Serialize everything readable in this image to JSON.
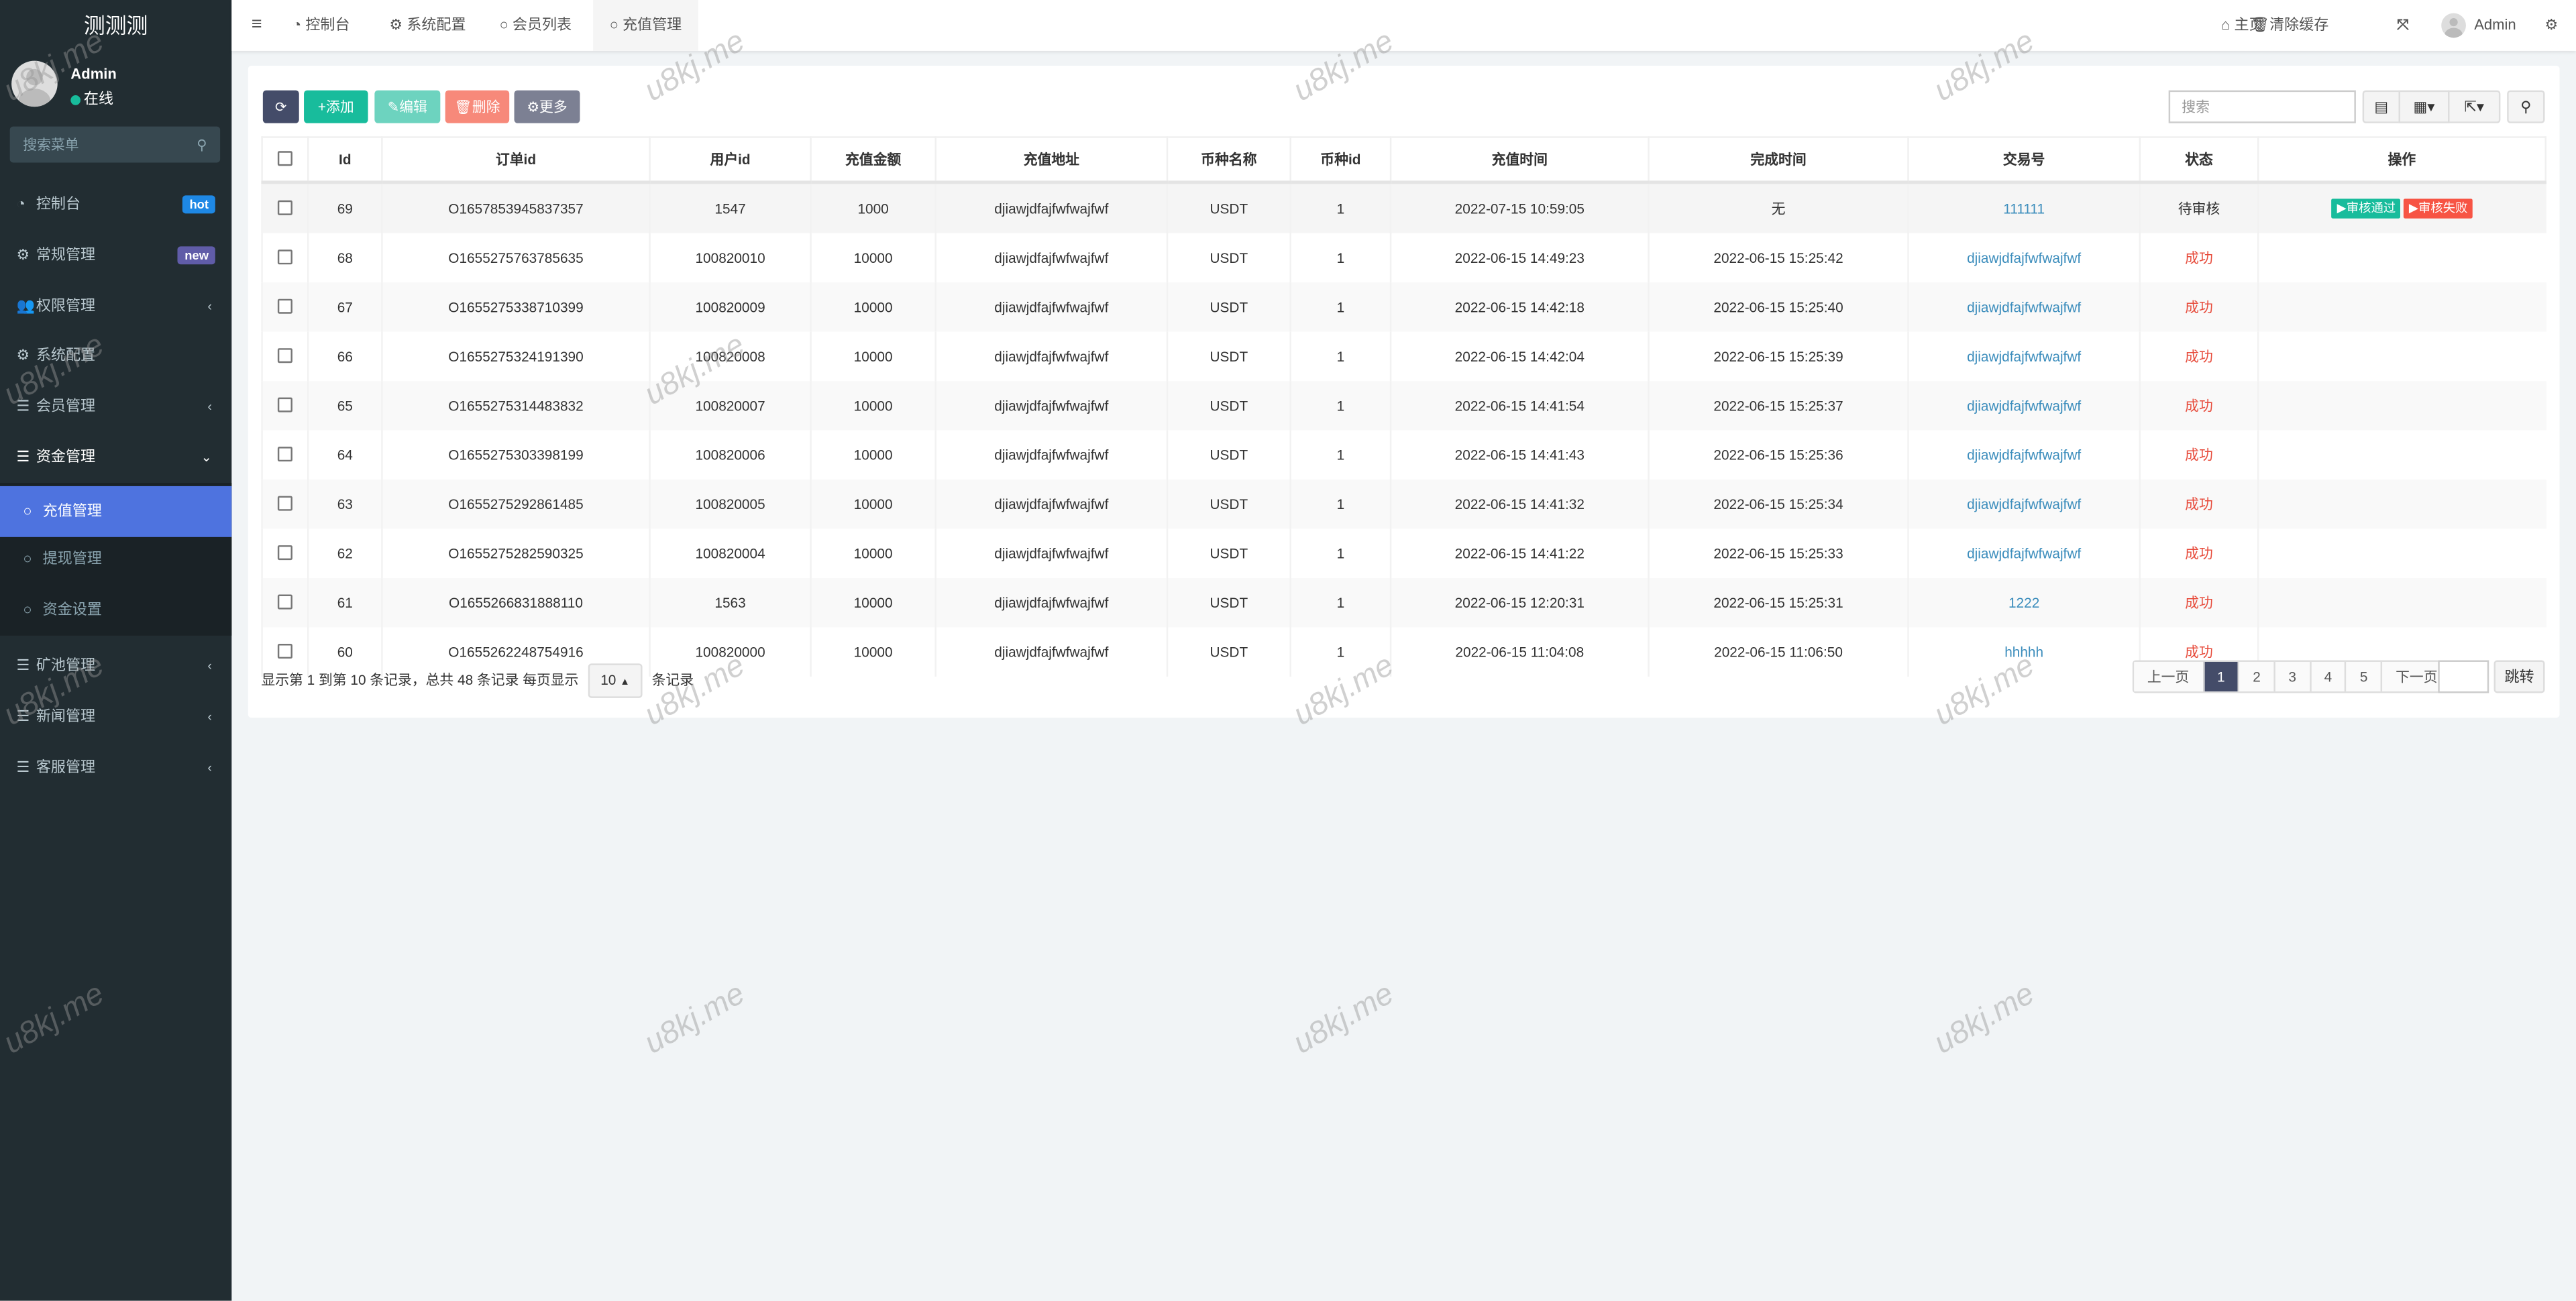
{
  "app": {
    "logo": "测测测",
    "user": "Admin",
    "status": "在线",
    "search_placeholder": "搜索菜单"
  },
  "sidebar": {
    "items": [
      {
        "label": "控制台",
        "icon": "dashboard-icon",
        "badge": "hot",
        "badge_color": "#1e88e5"
      },
      {
        "label": "常规管理",
        "icon": "cogs-icon",
        "badge": "new",
        "badge_color": "#605ca8"
      },
      {
        "label": "权限管理",
        "icon": "users-icon",
        "arrow": "‹"
      },
      {
        "label": "系统配置",
        "icon": "gear-icon"
      },
      {
        "label": "会员管理",
        "icon": "list-icon",
        "arrow": "‹"
      },
      {
        "label": "资金管理",
        "icon": "list-icon",
        "arrow": "⌄"
      },
      {
        "label": "充值管理",
        "icon": "circle-icon",
        "active": true
      },
      {
        "label": "提现管理",
        "icon": "circle-icon"
      },
      {
        "label": "资金设置",
        "icon": "circle-icon"
      },
      {
        "label": "矿池管理",
        "icon": "list-icon",
        "arrow": "‹"
      },
      {
        "label": "新闻管理",
        "icon": "list-icon",
        "arrow": "‹"
      },
      {
        "label": "客服管理",
        "icon": "list-icon",
        "arrow": "‹"
      }
    ]
  },
  "header": {
    "tabs": [
      {
        "label": "控制台",
        "icon": "dashboard-icon"
      },
      {
        "label": "系统配置",
        "icon": "gear-icon"
      },
      {
        "label": "会员列表",
        "icon": "circle-icon"
      },
      {
        "label": "充值管理",
        "icon": "circle-icon",
        "active": true
      }
    ],
    "home": "主页",
    "clear_cache": "清除缓存",
    "user": "Admin"
  },
  "toolbar": {
    "add": "添加",
    "edit": "编辑",
    "delete": "删除",
    "more": "更多",
    "search_placeholder": "搜索",
    "colors": {
      "refresh": "#444c69",
      "add": "#18bc9c",
      "edit": "#6dd3bf",
      "delete": "#f7897a",
      "more": "#7c8093"
    }
  },
  "table": {
    "columns": [
      "Id",
      "订单id",
      "用户id",
      "充值金额",
      "充值地址",
      "币种名称",
      "币种id",
      "充值时间",
      "完成时间",
      "交易号",
      "状态",
      "操作"
    ],
    "rows": [
      {
        "id": "69",
        "order": "O1657853945837357",
        "uid": "1547",
        "amount": "1000",
        "addr": "djiawjdfajfwfwajfwf",
        "coin": "USDT",
        "coin_id": "1",
        "time": "2022-07-15 10:59:05",
        "done": "无",
        "tx": "111111",
        "status": "待审核",
        "pending": true
      },
      {
        "id": "68",
        "order": "O1655275763785635",
        "uid": "100820010",
        "amount": "10000",
        "addr": "djiawjdfajfwfwajfwf",
        "coin": "USDT",
        "coin_id": "1",
        "time": "2022-06-15 14:49:23",
        "done": "2022-06-15 15:25:42",
        "tx": "djiawjdfajfwfwajfwf",
        "status": "成功"
      },
      {
        "id": "67",
        "order": "O1655275338710399",
        "uid": "100820009",
        "amount": "10000",
        "addr": "djiawjdfajfwfwajfwf",
        "coin": "USDT",
        "coin_id": "1",
        "time": "2022-06-15 14:42:18",
        "done": "2022-06-15 15:25:40",
        "tx": "djiawjdfajfwfwajfwf",
        "status": "成功"
      },
      {
        "id": "66",
        "order": "O1655275324191390",
        "uid": "100820008",
        "amount": "10000",
        "addr": "djiawjdfajfwfwajfwf",
        "coin": "USDT",
        "coin_id": "1",
        "time": "2022-06-15 14:42:04",
        "done": "2022-06-15 15:25:39",
        "tx": "djiawjdfajfwfwajfwf",
        "status": "成功"
      },
      {
        "id": "65",
        "order": "O1655275314483832",
        "uid": "100820007",
        "amount": "10000",
        "addr": "djiawjdfajfwfwajfwf",
        "coin": "USDT",
        "coin_id": "1",
        "time": "2022-06-15 14:41:54",
        "done": "2022-06-15 15:25:37",
        "tx": "djiawjdfajfwfwajfwf",
        "status": "成功"
      },
      {
        "id": "64",
        "order": "O1655275303398199",
        "uid": "100820006",
        "amount": "10000",
        "addr": "djiawjdfajfwfwajfwf",
        "coin": "USDT",
        "coin_id": "1",
        "time": "2022-06-15 14:41:43",
        "done": "2022-06-15 15:25:36",
        "tx": "djiawjdfajfwfwajfwf",
        "status": "成功"
      },
      {
        "id": "63",
        "order": "O1655275292861485",
        "uid": "100820005",
        "amount": "10000",
        "addr": "djiawjdfajfwfwajfwf",
        "coin": "USDT",
        "coin_id": "1",
        "time": "2022-06-15 14:41:32",
        "done": "2022-06-15 15:25:34",
        "tx": "djiawjdfajfwfwajfwf",
        "status": "成功"
      },
      {
        "id": "62",
        "order": "O1655275282590325",
        "uid": "100820004",
        "amount": "10000",
        "addr": "djiawjdfajfwfwajfwf",
        "coin": "USDT",
        "coin_id": "1",
        "time": "2022-06-15 14:41:22",
        "done": "2022-06-15 15:25:33",
        "tx": "djiawjdfajfwfwajfwf",
        "status": "成功"
      },
      {
        "id": "61",
        "order": "O1655266831888110",
        "uid": "1563",
        "amount": "10000",
        "addr": "djiawjdfajfwfwajfwf",
        "coin": "USDT",
        "coin_id": "1",
        "time": "2022-06-15 12:20:31",
        "done": "2022-06-15 15:25:31",
        "tx": "1222",
        "status": "成功"
      },
      {
        "id": "60",
        "order": "O1655262248754916",
        "uid": "100820000",
        "amount": "10000",
        "addr": "djiawjdfajfwfwajfwf",
        "coin": "USDT",
        "coin_id": "1",
        "time": "2022-06-15 11:04:08",
        "done": "2022-06-15 11:06:50",
        "tx": "hhhhh",
        "status": "成功"
      }
    ],
    "approve": "审核通过",
    "reject": "审核失败",
    "approve_color": "#18bc9c",
    "reject_color": "#f75444"
  },
  "footer": {
    "summary": "显示第 1 到第 10 条记录，总共 48 条记录 每页显示",
    "page_size": "10",
    "suffix": "条记录",
    "prev": "上一页",
    "pages": [
      "1",
      "2",
      "3",
      "4",
      "5"
    ],
    "current_page": "1",
    "next": "下一页",
    "jump": "跳转"
  },
  "watermark": "u8kj.me"
}
